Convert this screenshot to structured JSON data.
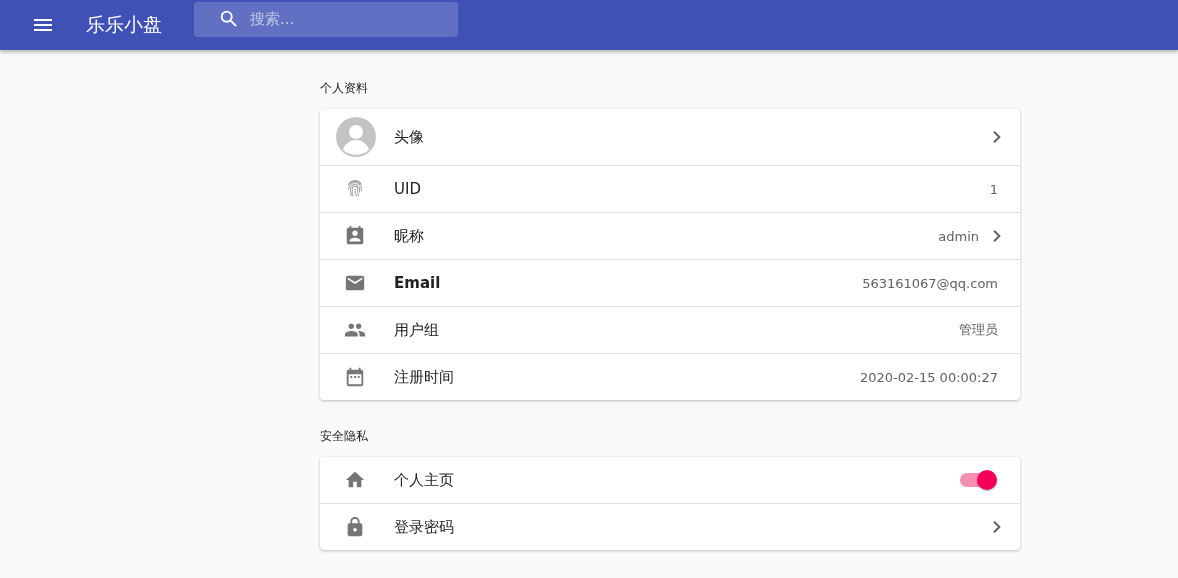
{
  "app_bar": {
    "title": "乐乐小盘",
    "search": {
      "placeholder": "搜索..."
    }
  },
  "sections": [
    {
      "title": "个人资料",
      "rows": [
        {
          "kind": "avatar",
          "label": "头像",
          "bold": false
        },
        {
          "kind": "info",
          "label": "UID",
          "value": "1",
          "bold": false
        },
        {
          "kind": "link",
          "label": "昵称",
          "value": "admin",
          "bold": false
        },
        {
          "kind": "info",
          "label": "Email",
          "value": "563161067@qq.com",
          "bold": true
        },
        {
          "kind": "info",
          "label": "用户组",
          "value": "管理员",
          "bold": false
        },
        {
          "kind": "info",
          "label": "注册时间",
          "value": "2020-02-15 00:00:27",
          "bold": false
        }
      ]
    },
    {
      "title": "安全隐私",
      "rows": [
        {
          "kind": "switch",
          "label": "个人主页",
          "on": true,
          "bold": false
        },
        {
          "kind": "link",
          "label": "登录密码",
          "bold": false
        }
      ]
    }
  ]
}
